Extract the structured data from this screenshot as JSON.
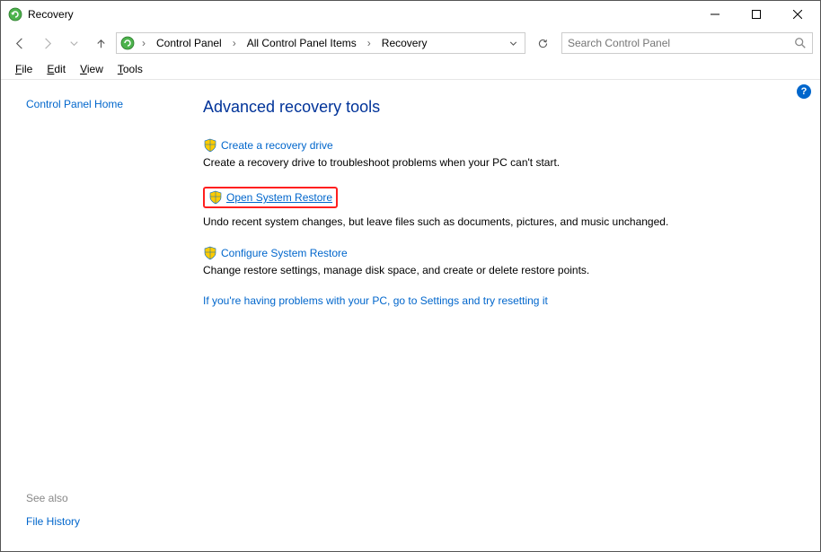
{
  "window": {
    "title": "Recovery"
  },
  "breadcrumbs": {
    "item1": "Control Panel",
    "item2": "All Control Panel Items",
    "item3": "Recovery"
  },
  "search": {
    "placeholder": "Search Control Panel"
  },
  "menu": {
    "file": "File",
    "edit": "Edit",
    "view": "View",
    "tools": "Tools"
  },
  "sidebar": {
    "home": "Control Panel Home",
    "see_also": "See also",
    "file_history": "File History"
  },
  "main": {
    "heading": "Advanced recovery tools",
    "tools": [
      {
        "title": "Create a recovery drive",
        "desc": "Create a recovery drive to troubleshoot problems when your PC can't start."
      },
      {
        "title": "Open System Restore",
        "desc": "Undo recent system changes, but leave files such as documents, pictures, and music unchanged."
      },
      {
        "title": "Configure System Restore",
        "desc": "Change restore settings, manage disk space, and create or delete restore points."
      }
    ],
    "trouble": "If you're having problems with your PC, go to Settings and try resetting it"
  },
  "help": {
    "label": "?"
  }
}
